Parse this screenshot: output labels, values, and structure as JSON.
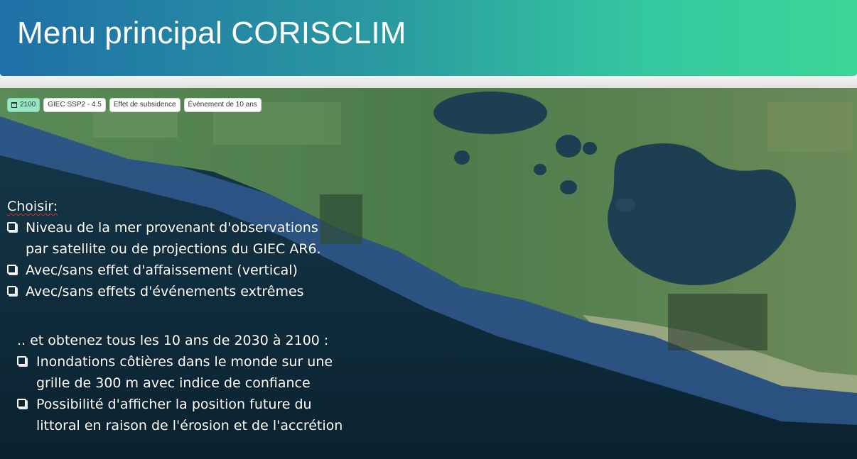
{
  "header": {
    "title": "Menu principal CORISCLIM"
  },
  "filters": {
    "year": "2100",
    "scenario": "GIEC SSP2 - 4.5",
    "subsidence": "Effet de subsidence",
    "event": "Événement de 10 ans"
  },
  "choose": {
    "title": "Choisir:",
    "items": [
      {
        "line1": "Niveau de la mer provenant d'observations",
        "line2": "par satellite ou de projections du GIEC AR6."
      },
      {
        "line1": "Avec/sans effet d'affaissement (vertical)"
      },
      {
        "line1": "Avec/sans effets d'événements extrêmes"
      }
    ]
  },
  "results": {
    "lead": ".. et obtenez tous les 10 ans de 2030 à 2100 :",
    "items": [
      {
        "line1": "Inondations côtières dans le monde sur une",
        "line2": "grille de 300 m avec indice de confiance"
      },
      {
        "line1": "Possibilité d'afficher la position future du",
        "line2": "littoral en raison de l'érosion et de l'accrétion"
      }
    ]
  },
  "colors": {
    "header_start": "#1f6fa8",
    "header_end": "#3dd598",
    "active_chip": "#9be5c5",
    "ocean": "#0f2a3a",
    "land": "#4f7d4f",
    "flood": "#3a6fb0"
  }
}
